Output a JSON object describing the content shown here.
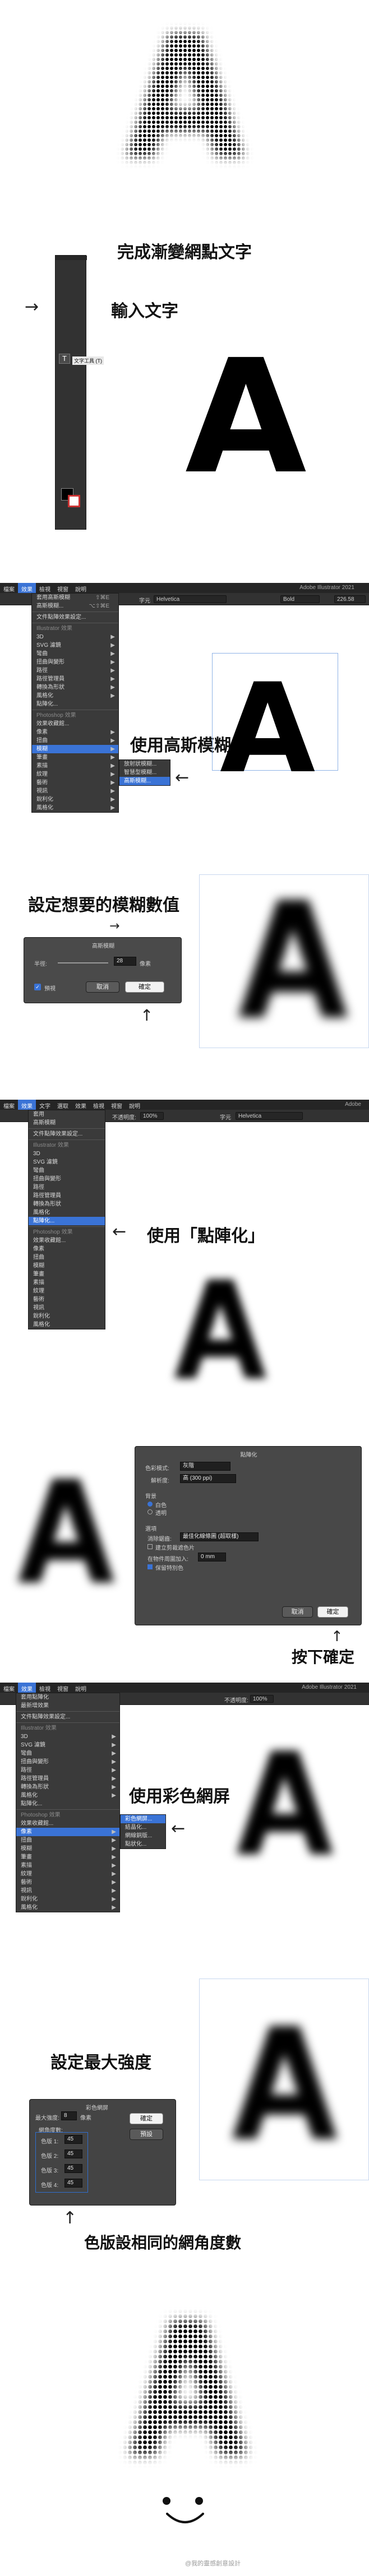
{
  "captions": {
    "title": "完成漸變網點文字",
    "step1": "輸入文字",
    "step2": "使用高斯模糊",
    "step3": "設定想要的模糊數值",
    "step4": "使用「點陣化」",
    "step5": "按下確定",
    "step6": "使用彩色網屏",
    "step7": "設定最大強度",
    "step8": "色版設相同的網角度數",
    "arrow": "→",
    "arrow_up": "↑",
    "letter": "A",
    "watermark": "@我的靈感創意設計"
  },
  "toolbar": {
    "tooltip": "文字工具 (T)"
  },
  "screen2": {
    "menubar": [
      "檔案",
      "效果",
      "檢視",
      "視窗",
      "說明"
    ],
    "menubar_active": 1,
    "app_title": "Adobe Illustrator 2021",
    "font": "Helvetica",
    "weight": "Bold",
    "size": "226.58",
    "char_label": "字元",
    "top_items": [
      {
        "label": "套用高斯模糊",
        "shortcut": "⇧⌘E"
      },
      {
        "label": "高斯模糊...",
        "shortcut": "⌥⇧⌘E"
      }
    ],
    "doc_item": "文件點陣效果設定...",
    "ai_header": "Illustrator 效果",
    "ai_items": [
      "3D",
      "SVG 濾鏡",
      "彎曲",
      "扭曲與變形",
      "路徑",
      "路徑管理員",
      "轉換為形狀",
      "風格化",
      "點陣化..."
    ],
    "ps_header": "Photoshop 效果",
    "ps_items": [
      "效果收藏館...",
      "像素",
      "扭曲",
      "模糊",
      "筆畫",
      "素描",
      "紋理",
      "藝術",
      "視訊",
      "銳利化",
      "風格化"
    ],
    "ps_highlight": 3,
    "submenu": [
      "放射狀模糊...",
      "智慧型模糊...",
      "高斯模糊..."
    ],
    "submenu_highlight": 2
  },
  "dialog_blur": {
    "title": "高斯模糊",
    "radius_label": "半徑:",
    "radius_value": "28",
    "unit": "像素",
    "preview_label": "預視",
    "cancel": "取消",
    "ok": "確定"
  },
  "screen3": {
    "menubar": [
      "檔案",
      "效果",
      "文字",
      "選取",
      "效果",
      "檢視",
      "視窗",
      "說明"
    ],
    "menubar_active": 1,
    "app_title": "Adobe",
    "opacity_label": "不透明度:",
    "opacity": "100%",
    "font": "Helvetica",
    "char_label": "字元",
    "top_items": [
      "套用",
      "高斯模糊"
    ],
    "doc_item": "文件點陣效果設定...",
    "ai_header": "Illustrator 效果",
    "ai_items": [
      "3D",
      "SVG 濾鏡",
      "彎曲",
      "扭曲與變形",
      "路徑",
      "路徑管理員",
      "轉換為形狀",
      "風格化",
      "點陣化..."
    ],
    "ai_highlight": 8,
    "ps_header": "Photoshop 效果",
    "ps_items": [
      "效果收藏館...",
      "像素",
      "扭曲",
      "模糊",
      "筆畫",
      "素描",
      "紋理",
      "藝術",
      "視訊",
      "銳利化",
      "風格化"
    ]
  },
  "dialog_raster": {
    "title": "點陣化",
    "color_model_label": "色彩模式:",
    "color_model": "灰階",
    "resolution_label": "解析度:",
    "resolution": "高 (300 ppi)",
    "background_label": "背景",
    "bg_white": "白色",
    "bg_transparent": "透明",
    "options_label": "選項",
    "antialias_label": "消除鋸齒:",
    "antialias": "最佳化線條圖 (超取樣)",
    "clipping_label": "建立剪裁遮色片",
    "add_around_label": "在物件周圍加入:",
    "add_around_value": "0 mm",
    "keep_spot_label": "保留特別色",
    "cancel": "取消",
    "ok": "確定"
  },
  "screen4": {
    "menubar": [
      "檔案",
      "效果",
      "檢視",
      "視窗",
      "說明"
    ],
    "menubar_active": 1,
    "app_title": "Adobe Illustrator 2021",
    "opacity_label": "不透明度:",
    "opacity": "100%",
    "top_items": [
      "套用點陣化",
      "最新增效果"
    ],
    "doc_item": "文件點陣效果設定...",
    "ai_header": "Illustrator 效果",
    "ai_items": [
      "3D",
      "SVG 濾鏡",
      "彎曲",
      "扭曲與變形",
      "路徑",
      "路徑管理員",
      "轉換為形狀",
      "風格化",
      "點陣化..."
    ],
    "ps_header": "Photoshop 效果",
    "ps_items": [
      "效果收藏館...",
      "像素",
      "扭曲",
      "模糊",
      "筆畫",
      "素描",
      "紋理",
      "藝術",
      "視訊",
      "銳利化",
      "風格化"
    ],
    "ps_highlight": 1,
    "submenu": [
      "彩色網屏...",
      "結晶化...",
      "網線銅版...",
      "點狀化..."
    ],
    "submenu_highlight": 0
  },
  "dialog_halftone": {
    "title": "彩色網屏",
    "max_radius_label": "最大強度:",
    "max_radius": "8",
    "unit": "像素",
    "angles_label": "網角度數:",
    "channels": [
      {
        "label": "色版 1:",
        "value": "45"
      },
      {
        "label": "色版 2:",
        "value": "45"
      },
      {
        "label": "色版 3:",
        "value": "45"
      },
      {
        "label": "色版 4:",
        "value": "45"
      }
    ],
    "ok": "確定",
    "reset": "預設"
  },
  "colors": {
    "ui_dark": "#2e2e2e",
    "highlight": "#3a73d6",
    "guide": "#8fb3e6"
  }
}
